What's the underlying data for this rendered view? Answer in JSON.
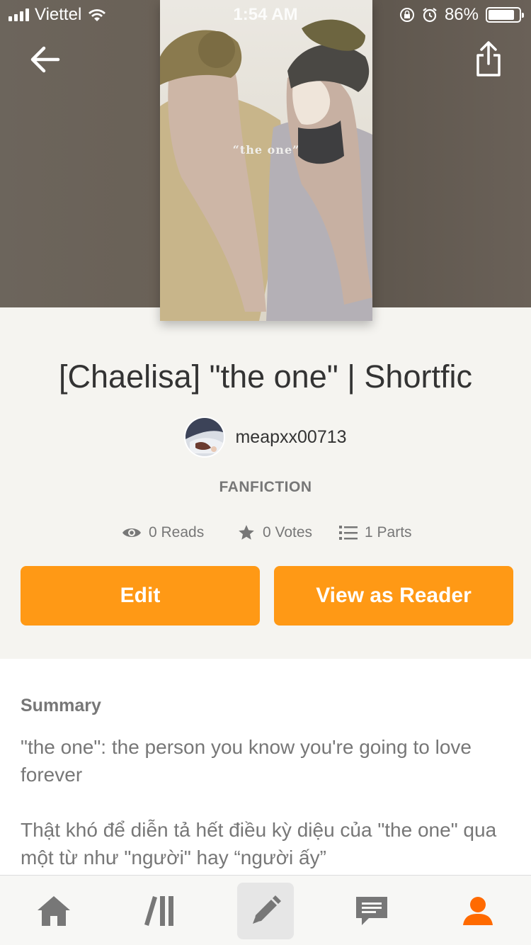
{
  "status_bar": {
    "carrier": "Viettel",
    "time": "1:54 AM",
    "battery_percent": "86%",
    "battery_level": 0.86,
    "icons": [
      "signal-icon",
      "wifi-icon",
      "rotation-lock-icon",
      "alarm-icon",
      "battery-icon"
    ]
  },
  "header": {
    "back_icon": "arrow-left-icon",
    "share_icon": "share-icon"
  },
  "cover": {
    "text": "“the one”"
  },
  "story": {
    "title": "[Chaelisa] \"the one\" | Shortfic",
    "author": "meapxx00713",
    "category": "FANFICTION"
  },
  "stats": {
    "reads": "0 Reads",
    "votes": "0 Votes",
    "parts": "1 Parts"
  },
  "actions": {
    "edit_label": "Edit",
    "reader_label": "View as Reader"
  },
  "summary": {
    "heading": "Summary",
    "paragraphs": [
      "\"the one\": the person you know you're going to love forever",
      "Thật khó để diễn tả hết điều kỳ diệu của \"the one\" qua một từ như \"người\" hay “người ấy”"
    ]
  },
  "tabbar": {
    "items": [
      "home-icon",
      "library-icon",
      "write-icon",
      "messages-icon",
      "profile-icon"
    ],
    "active": "write-icon"
  },
  "colors": {
    "accent": "#ff9915",
    "profile_active": "#ff6a00",
    "background": "#f5f4f0"
  }
}
